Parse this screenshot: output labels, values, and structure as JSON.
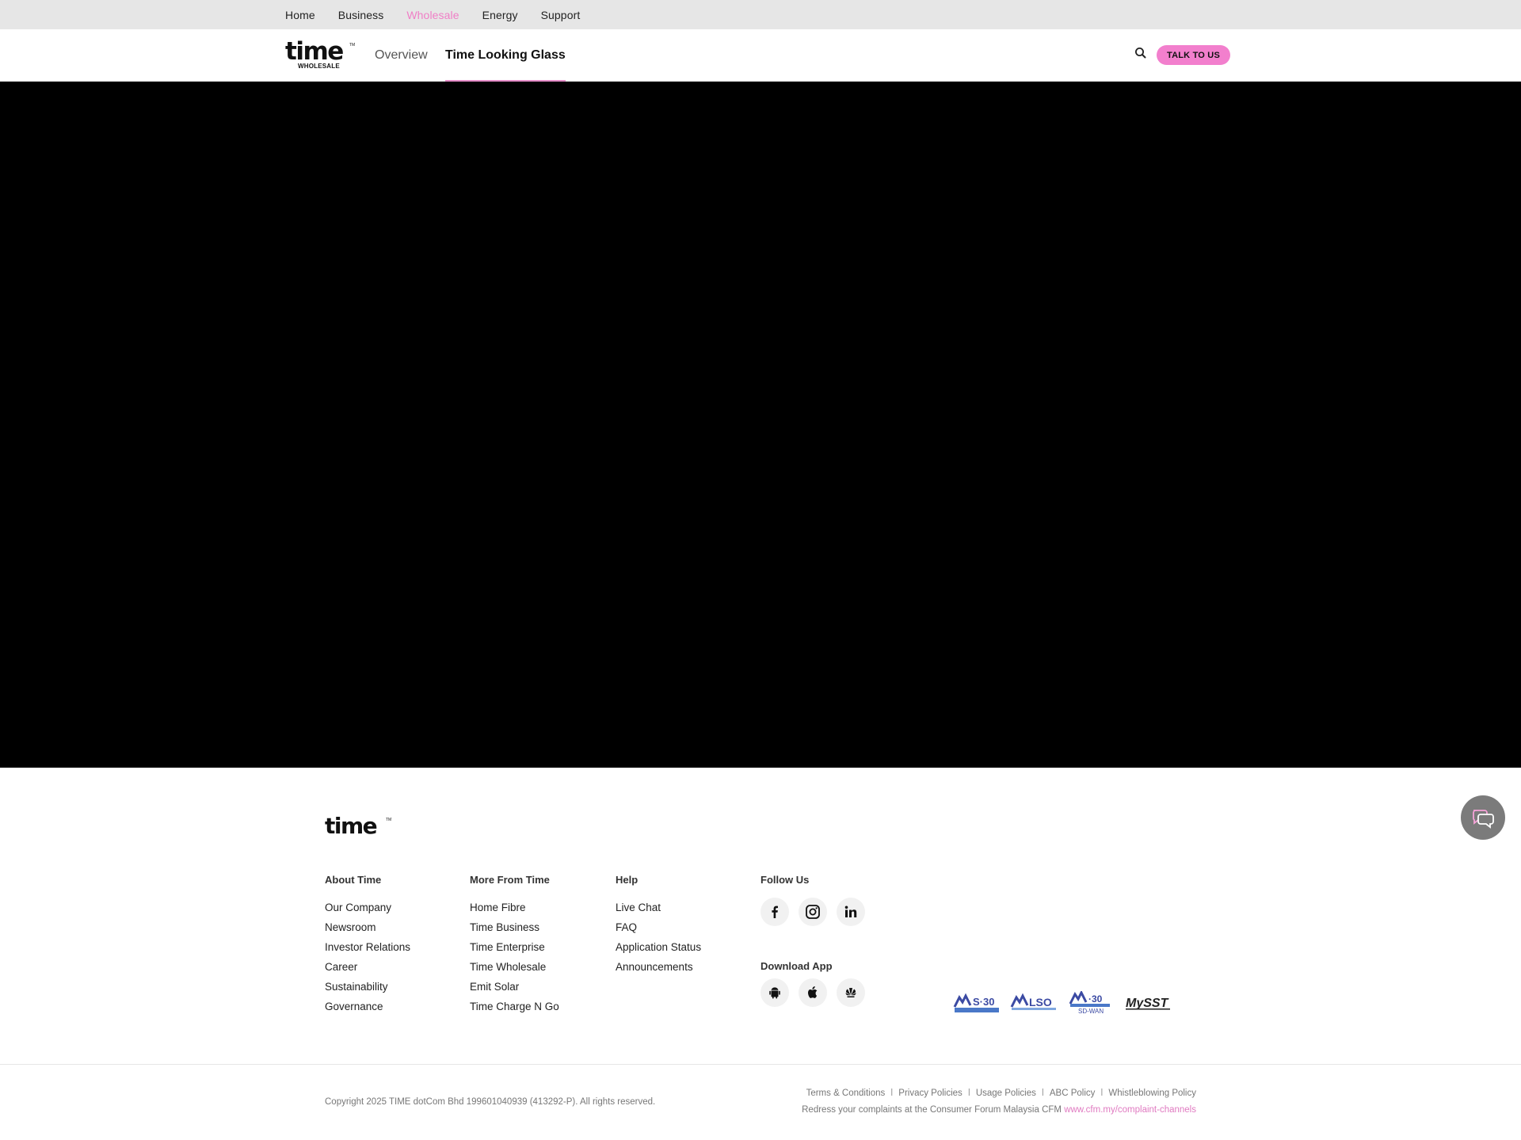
{
  "topbar": {
    "links": [
      {
        "label": "Home",
        "active": false
      },
      {
        "label": "Business",
        "active": false
      },
      {
        "label": "Wholesale",
        "active": true
      },
      {
        "label": "Energy",
        "active": false
      },
      {
        "label": "Support",
        "active": false
      }
    ]
  },
  "header": {
    "logo_word": "time",
    "logo_sub": "WHOLESALE",
    "logo_tm": "TM",
    "tabs": [
      {
        "label": "Overview",
        "active": false
      },
      {
        "label": "Time Looking Glass",
        "active": true
      }
    ],
    "search_icon": "search-icon",
    "cta_label": "TALK TO US",
    "accent_color": "#f27fcd"
  },
  "hero": {
    "background": "#000000"
  },
  "footer": {
    "logo_word": "time",
    "logo_tm": "TM",
    "columns": [
      {
        "heading": "About Time",
        "links": [
          "Our Company",
          "Newsroom",
          "Investor Relations",
          "Career",
          "Sustainability",
          "Governance"
        ]
      },
      {
        "heading": "More From Time",
        "links": [
          "Home Fibre",
          "Time Business",
          "Time Enterprise",
          "Time Wholesale",
          "Emit Solar",
          "Time Charge N Go"
        ]
      },
      {
        "heading": "Help",
        "links": [
          "Live Chat",
          "FAQ",
          "Application Status",
          "Announcements"
        ]
      }
    ],
    "follow_heading": "Follow Us",
    "social_icons": [
      "facebook-icon",
      "instagram-icon",
      "linkedin-icon"
    ],
    "download_heading": "Download App",
    "app_icons": [
      "android-icon",
      "apple-icon",
      "huawei-icon"
    ],
    "certifications": [
      "MS ISO 9001:2015 certification logo",
      "MS ISO 27001 certification logo",
      "MS ISO SD-WAN certification logo",
      "MySST registered logo"
    ],
    "chat_icon": "chat-bubbles-icon",
    "copyright": "Copyright 2025 TIME dotCom Bhd 199601040939 (413292-P). All rights reserved.",
    "legal_links": [
      "Terms & Conditions",
      "Privacy Policies",
      "Usage Policies",
      "ABC Policy",
      "Whistleblowing Policy"
    ],
    "legal_separator": "ǀ",
    "redress_text": "Redress your complaints at the Consumer Forum Malaysia CFM",
    "redress_link": "www.cfm.my/complaint-channels"
  }
}
